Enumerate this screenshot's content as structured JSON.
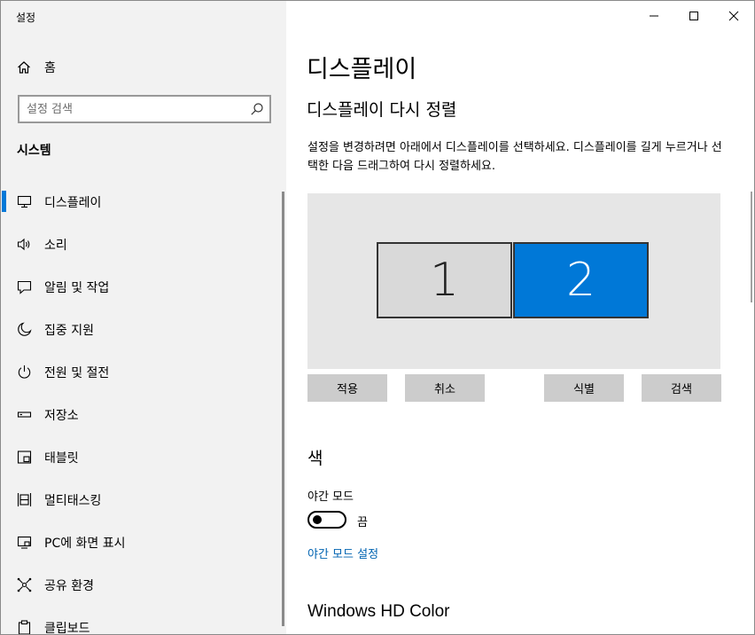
{
  "window": {
    "title": "설정",
    "controls": {
      "minimize": "minimize",
      "maximize": "maximize",
      "close": "close"
    }
  },
  "sidebar": {
    "home_label": "홈",
    "search_placeholder": "설정 검색",
    "section_title": "시스템",
    "items": [
      {
        "label": "디스플레이",
        "icon": "monitor-icon",
        "selected": true
      },
      {
        "label": "소리",
        "icon": "speaker-icon",
        "selected": false
      },
      {
        "label": "알림 및 작업",
        "icon": "notification-icon",
        "selected": false
      },
      {
        "label": "집중 지원",
        "icon": "moon-icon",
        "selected": false
      },
      {
        "label": "전원 및 절전",
        "icon": "power-icon",
        "selected": false
      },
      {
        "label": "저장소",
        "icon": "storage-icon",
        "selected": false
      },
      {
        "label": "태블릿",
        "icon": "tablet-icon",
        "selected": false
      },
      {
        "label": "멀티태스킹",
        "icon": "multitasking-icon",
        "selected": false
      },
      {
        "label": "PC에 화면 표시",
        "icon": "project-icon",
        "selected": false
      },
      {
        "label": "공유 환경",
        "icon": "shared-experiences-icon",
        "selected": false
      },
      {
        "label": "클립보드",
        "icon": "clipboard-icon",
        "selected": false
      }
    ]
  },
  "main": {
    "title": "디스플레이",
    "arrange_title": "디스플레이 다시 정렬",
    "arrange_description": "설정을 변경하려면 아래에서 디스플레이를 선택하세요. 디스플레이를 길게 누르거나 선택한 다음 드래그하여 다시 정렬하세요.",
    "monitors": [
      {
        "number": "1",
        "selected": false
      },
      {
        "number": "2",
        "selected": true
      }
    ],
    "buttons": {
      "apply": "적용",
      "cancel": "취소",
      "identify": "식별",
      "detect": "검색"
    },
    "color_section": "색",
    "night_light_label": "야간 모드",
    "night_light_state": "끔",
    "night_light_on": false,
    "night_light_link": "야간 모드 설정",
    "hd_color_title": "Windows HD Color"
  },
  "colors": {
    "accent": "#0078d7",
    "sidebar_bg": "#f2f2f2",
    "button_bg": "#cccccc",
    "link": "#0063b1"
  }
}
